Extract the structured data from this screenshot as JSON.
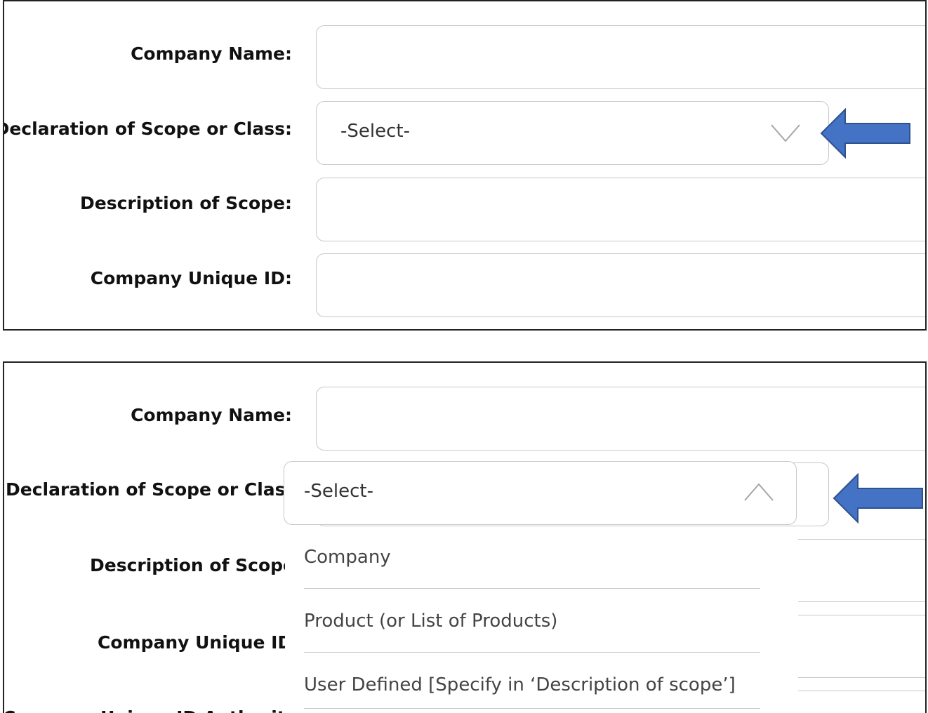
{
  "form_top": {
    "company_name_label": "Company Name:",
    "scope_label": "Declaration of Scope or Class:",
    "description_label": "Description of Scope:",
    "unique_id_label": "Company Unique ID:",
    "scope_select_value": "-Select-",
    "company_name_value": "",
    "description_value": "",
    "unique_id_value": ""
  },
  "form_bottom": {
    "company_name_label": "Company Name:",
    "scope_label": "Declaration of Scope or Class:",
    "description_label": "Description of Scope:",
    "unique_id_label": "Company Unique ID:",
    "authority_label": "Company Unique ID Authority:",
    "scope_select_value": "-Select-",
    "dropdown_open": true,
    "options": [
      "Company",
      "Product (or List of Products)",
      "User Defined [Specify in ‘Description of scope’]"
    ]
  },
  "colors": {
    "arrow_fill": "#4472c4",
    "arrow_stroke": "#2f528f",
    "field_border": "#c8c8c8"
  },
  "icons": {
    "closed_chevron": "chevron-down-icon",
    "open_chevron": "chevron-up-icon",
    "callout": "left-arrow-icon"
  }
}
